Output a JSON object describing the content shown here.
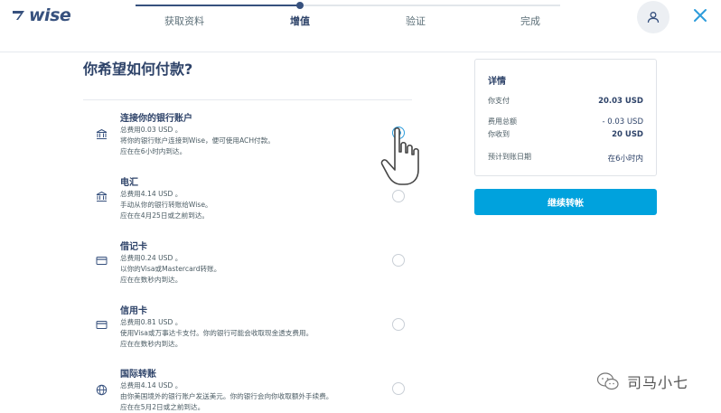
{
  "header": {
    "logo_text": "wise",
    "steps": [
      "获取资料",
      "增值",
      "验证",
      "完成"
    ],
    "active_step": 1
  },
  "main": {
    "title": "你希望如何付款?",
    "options": [
      {
        "title": "连接你的银行账户",
        "line1": "总费用0.03 USD 。",
        "line2": "将你的银行账户连接到Wise，便可使用ACH付款。",
        "line3": "应在在6小时内到达。",
        "icon": "bank-icon",
        "selected": true
      },
      {
        "title": "电汇",
        "line1": "总费用4.14 USD 。",
        "line2": "手动从你的银行转账给Wise。",
        "line3": "应在在4月25日或之前到达。",
        "icon": "bank-icon",
        "selected": false
      },
      {
        "title": "借记卡",
        "line1": "总费用0.24 USD 。",
        "line2": "以你的Visa或Mastercard转账。",
        "line3": "应在在数秒内到达。",
        "icon": "card-icon",
        "selected": false
      },
      {
        "title": "信用卡",
        "line1": "总费用0.81 USD 。",
        "line2": "使用Visa或万事达卡支付。你的银行可能会收取现金透支费用。",
        "line3": "应在在数秒内到达。",
        "icon": "card-icon",
        "selected": false
      },
      {
        "title": "国际转账",
        "line1": "总费用4.14 USD 。",
        "line2": "由你美国境外的银行账户发送美元。你的银行会向你收取额外手续费。",
        "line3": "应在在5月2日或之前到达。",
        "icon": "globe-icon",
        "selected": false
      }
    ]
  },
  "details": {
    "title": "详情",
    "rows": [
      {
        "label": "你支付",
        "value": "20.03 USD"
      },
      {
        "label": "费用总额",
        "value": "- 0.03 USD"
      },
      {
        "label": "你收到",
        "value": "20 USD"
      },
      {
        "label": "预计到账日期",
        "value": "在6小时内"
      }
    ],
    "button_label": "继续转帐"
  },
  "watermark": {
    "text": "司马小七"
  },
  "colors": {
    "primary_navy": "#37517e",
    "accent_blue": "#00a2dd",
    "radio_blue": "#2d9cdb"
  }
}
